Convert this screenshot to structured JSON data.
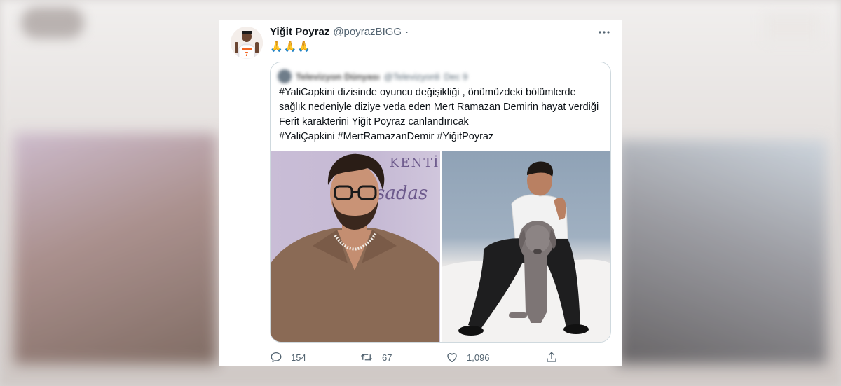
{
  "tweet": {
    "display_name": "Yiğit Poyraz",
    "handle": "@poyrazBIGG",
    "separator": "·",
    "text": "🙏🙏🙏",
    "more_icon": "more-horizontal-icon"
  },
  "quoted_tweet": {
    "author_blurred": "Televizyon Dünyası",
    "handle_blurred": "@Televizyonli",
    "date_blurred": "Dec 9",
    "lines": [
      "#YaliCapkini dizisinde oyuncu değişikliği , önümüzdeki bölümlerde",
      "sağlık nedeniyle diziye veda eden Mert Ramazan Demirin hayat verdiği",
      "Ferit karakterini Yiğit Poyraz canlandırıcak",
      "#YaliÇapkini #MertRamazanDemir #YiğitPoyraz"
    ],
    "media_text_1": "KENTİ",
    "media_text_2": "sadas"
  },
  "actions": {
    "replies": "154",
    "retweets": "67",
    "likes": "1,096"
  },
  "colors": {
    "text": "#0f1419",
    "secondary": "#536471",
    "border": "#cfd9de"
  }
}
